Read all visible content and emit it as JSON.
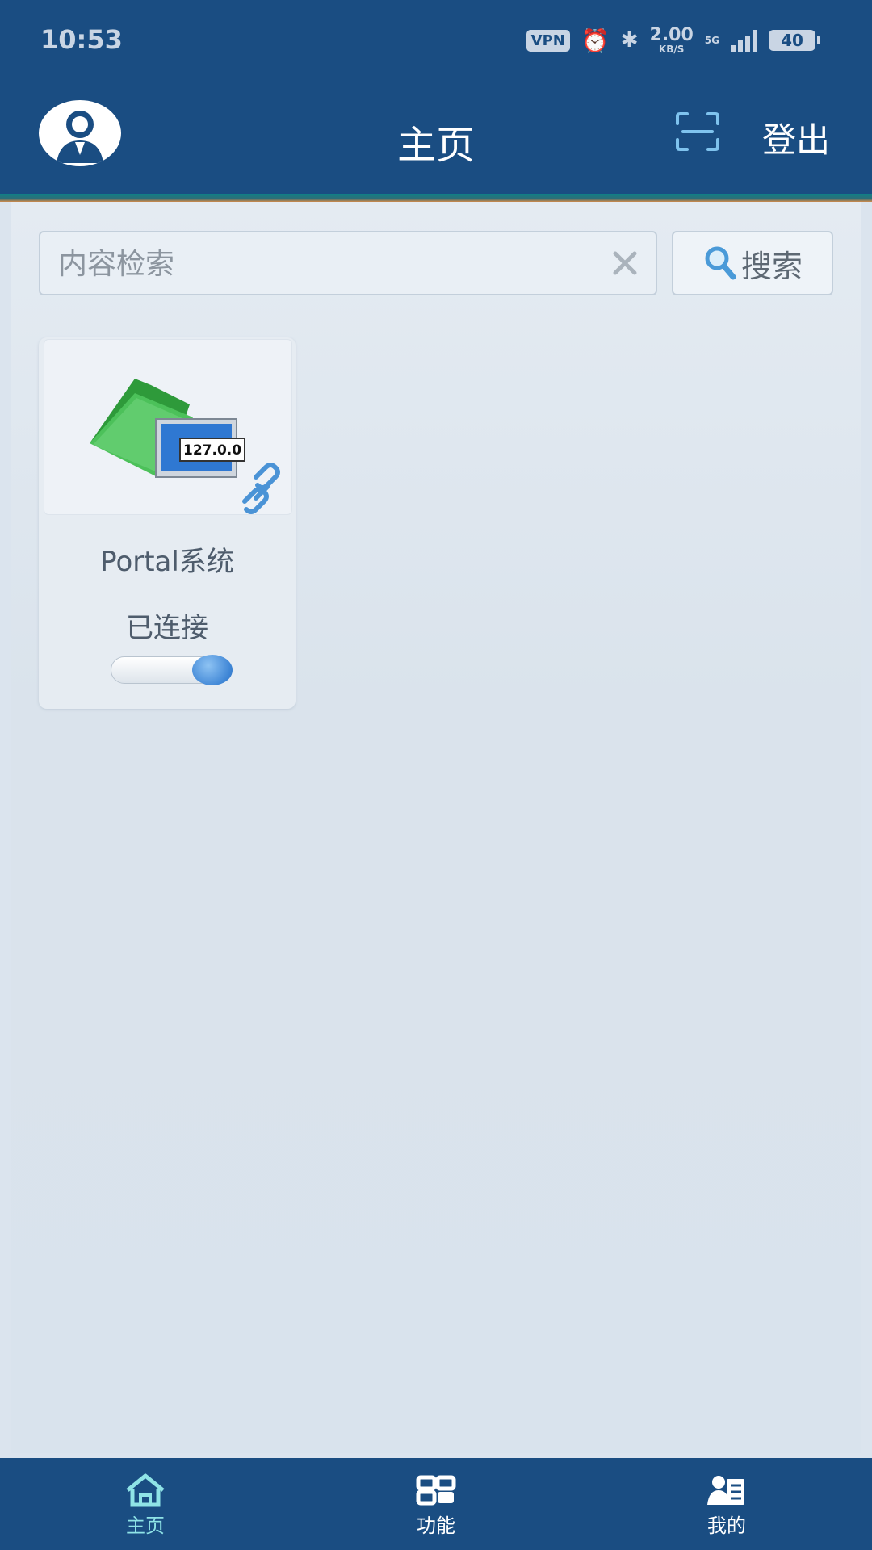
{
  "status_bar": {
    "time": "10:53",
    "vpn": "VPN",
    "speed_value": "2.00",
    "speed_unit": "KB/S",
    "network": "5G",
    "battery": "40",
    "icons": [
      "alarm-icon",
      "bluetooth-icon",
      "signal-icon",
      "battery-icon"
    ]
  },
  "header": {
    "title": "主页",
    "logout_label": "登出",
    "icons": [
      "avatar-icon",
      "scan-icon"
    ]
  },
  "search": {
    "placeholder": "内容检索",
    "value": "",
    "button_label": "搜索"
  },
  "cards": [
    {
      "title": "Portal系统",
      "status": "已连接",
      "connected": true,
      "image_label": "127.0.0",
      "icons": [
        "folder-network-icon",
        "link-icon"
      ]
    }
  ],
  "bottom_nav": [
    {
      "label": "主页",
      "icon": "home-icon",
      "active": true
    },
    {
      "label": "功能",
      "icon": "function-icon",
      "active": false
    },
    {
      "label": "我的",
      "icon": "profile-icon",
      "active": false
    }
  ],
  "colors": {
    "primary": "#1a4d82",
    "background": "#dbe4ee",
    "active_nav": "#8fe3e6",
    "toggle_on": "#3f86d6"
  }
}
